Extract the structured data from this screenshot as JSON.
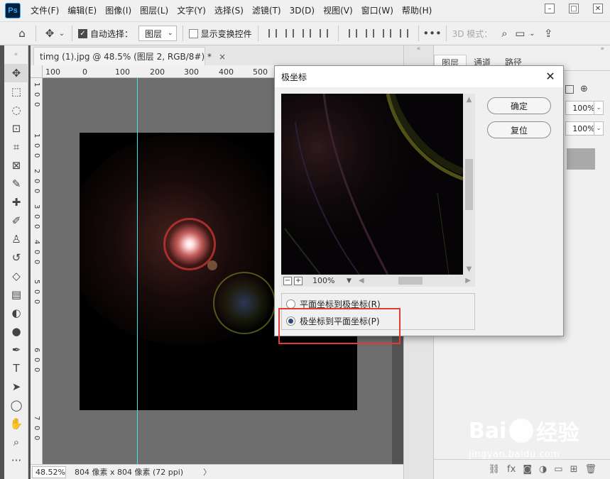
{
  "app": {
    "logo": "Ps",
    "menus": [
      "文件(F)",
      "编辑(E)",
      "图像(I)",
      "图层(L)",
      "文字(Y)",
      "选择(S)",
      "滤镜(T)",
      "3D(D)",
      "视图(V)",
      "窗口(W)",
      "帮助(H)"
    ]
  },
  "options_bar": {
    "auto_select_label": "自动选择：",
    "auto_select_checked": true,
    "layer_select_value": "图层",
    "show_transform_label": "显示变换控件",
    "three_d_mode": "3D 模式："
  },
  "document": {
    "tab_title": "timg (1).jpg @ 48.5% (图层 2, RGB/8#) *",
    "close_glyph": "×"
  },
  "rulers": {
    "horizontal": [
      "100",
      "0",
      "100",
      "200",
      "300",
      "400",
      "500"
    ],
    "vertical": [
      "1",
      "0",
      "0",
      "1",
      "0",
      "0",
      "2",
      "0",
      "0",
      "3",
      "0",
      "0",
      "4",
      "0",
      "0",
      "5",
      "0",
      "0",
      "6",
      "0",
      "0",
      "7",
      "0",
      "0"
    ]
  },
  "status": {
    "zoom": "48.52%",
    "info": "804 像素 x 804 像素 (72 ppi)",
    "arrow": "〉"
  },
  "panels": {
    "tabs": [
      "图层",
      "通道",
      "路径"
    ],
    "opacity_value": "100%",
    "fill_value": "100%"
  },
  "dialog": {
    "title": "极坐标",
    "ok_label": "确定",
    "reset_label": "复位",
    "preview_zoom": "100%",
    "option_rect_to_polar": "平面坐标到极坐标(R)",
    "option_polar_to_rect": "极坐标到平面坐标(P)",
    "selected_option": "polar_to_rect"
  },
  "watermark": {
    "brand": "Bai  经验",
    "brand_left": "Bai",
    "brand_right": "经验",
    "url": "jingyan.baidu.com"
  }
}
